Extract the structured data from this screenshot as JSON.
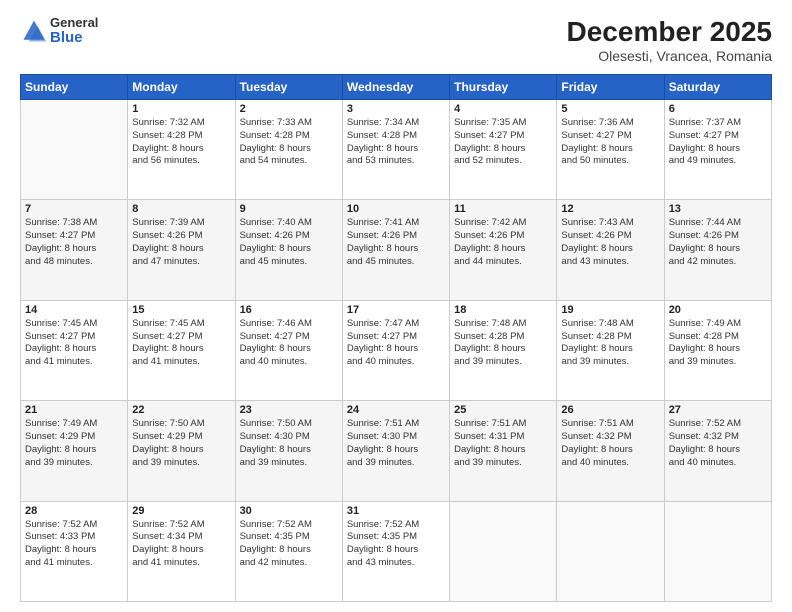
{
  "header": {
    "logo_general": "General",
    "logo_blue": "Blue",
    "title": "December 2025",
    "location": "Olesesti, Vrancea, Romania"
  },
  "days_of_week": [
    "Sunday",
    "Monday",
    "Tuesday",
    "Wednesday",
    "Thursday",
    "Friday",
    "Saturday"
  ],
  "weeks": [
    [
      {
        "day": "",
        "info": ""
      },
      {
        "day": "1",
        "info": "Sunrise: 7:32 AM\nSunset: 4:28 PM\nDaylight: 8 hours\nand 56 minutes."
      },
      {
        "day": "2",
        "info": "Sunrise: 7:33 AM\nSunset: 4:28 PM\nDaylight: 8 hours\nand 54 minutes."
      },
      {
        "day": "3",
        "info": "Sunrise: 7:34 AM\nSunset: 4:28 PM\nDaylight: 8 hours\nand 53 minutes."
      },
      {
        "day": "4",
        "info": "Sunrise: 7:35 AM\nSunset: 4:27 PM\nDaylight: 8 hours\nand 52 minutes."
      },
      {
        "day": "5",
        "info": "Sunrise: 7:36 AM\nSunset: 4:27 PM\nDaylight: 8 hours\nand 50 minutes."
      },
      {
        "day": "6",
        "info": "Sunrise: 7:37 AM\nSunset: 4:27 PM\nDaylight: 8 hours\nand 49 minutes."
      }
    ],
    [
      {
        "day": "7",
        "info": "Sunrise: 7:38 AM\nSunset: 4:27 PM\nDaylight: 8 hours\nand 48 minutes."
      },
      {
        "day": "8",
        "info": "Sunrise: 7:39 AM\nSunset: 4:26 PM\nDaylight: 8 hours\nand 47 minutes."
      },
      {
        "day": "9",
        "info": "Sunrise: 7:40 AM\nSunset: 4:26 PM\nDaylight: 8 hours\nand 45 minutes."
      },
      {
        "day": "10",
        "info": "Sunrise: 7:41 AM\nSunset: 4:26 PM\nDaylight: 8 hours\nand 45 minutes."
      },
      {
        "day": "11",
        "info": "Sunrise: 7:42 AM\nSunset: 4:26 PM\nDaylight: 8 hours\nand 44 minutes."
      },
      {
        "day": "12",
        "info": "Sunrise: 7:43 AM\nSunset: 4:26 PM\nDaylight: 8 hours\nand 43 minutes."
      },
      {
        "day": "13",
        "info": "Sunrise: 7:44 AM\nSunset: 4:26 PM\nDaylight: 8 hours\nand 42 minutes."
      }
    ],
    [
      {
        "day": "14",
        "info": "Sunrise: 7:45 AM\nSunset: 4:27 PM\nDaylight: 8 hours\nand 41 minutes."
      },
      {
        "day": "15",
        "info": "Sunrise: 7:45 AM\nSunset: 4:27 PM\nDaylight: 8 hours\nand 41 minutes."
      },
      {
        "day": "16",
        "info": "Sunrise: 7:46 AM\nSunset: 4:27 PM\nDaylight: 8 hours\nand 40 minutes."
      },
      {
        "day": "17",
        "info": "Sunrise: 7:47 AM\nSunset: 4:27 PM\nDaylight: 8 hours\nand 40 minutes."
      },
      {
        "day": "18",
        "info": "Sunrise: 7:48 AM\nSunset: 4:28 PM\nDaylight: 8 hours\nand 39 minutes."
      },
      {
        "day": "19",
        "info": "Sunrise: 7:48 AM\nSunset: 4:28 PM\nDaylight: 8 hours\nand 39 minutes."
      },
      {
        "day": "20",
        "info": "Sunrise: 7:49 AM\nSunset: 4:28 PM\nDaylight: 8 hours\nand 39 minutes."
      }
    ],
    [
      {
        "day": "21",
        "info": "Sunrise: 7:49 AM\nSunset: 4:29 PM\nDaylight: 8 hours\nand 39 minutes."
      },
      {
        "day": "22",
        "info": "Sunrise: 7:50 AM\nSunset: 4:29 PM\nDaylight: 8 hours\nand 39 minutes."
      },
      {
        "day": "23",
        "info": "Sunrise: 7:50 AM\nSunset: 4:30 PM\nDaylight: 8 hours\nand 39 minutes."
      },
      {
        "day": "24",
        "info": "Sunrise: 7:51 AM\nSunset: 4:30 PM\nDaylight: 8 hours\nand 39 minutes."
      },
      {
        "day": "25",
        "info": "Sunrise: 7:51 AM\nSunset: 4:31 PM\nDaylight: 8 hours\nand 39 minutes."
      },
      {
        "day": "26",
        "info": "Sunrise: 7:51 AM\nSunset: 4:32 PM\nDaylight: 8 hours\nand 40 minutes."
      },
      {
        "day": "27",
        "info": "Sunrise: 7:52 AM\nSunset: 4:32 PM\nDaylight: 8 hours\nand 40 minutes."
      }
    ],
    [
      {
        "day": "28",
        "info": "Sunrise: 7:52 AM\nSunset: 4:33 PM\nDaylight: 8 hours\nand 41 minutes."
      },
      {
        "day": "29",
        "info": "Sunrise: 7:52 AM\nSunset: 4:34 PM\nDaylight: 8 hours\nand 41 minutes."
      },
      {
        "day": "30",
        "info": "Sunrise: 7:52 AM\nSunset: 4:35 PM\nDaylight: 8 hours\nand 42 minutes."
      },
      {
        "day": "31",
        "info": "Sunrise: 7:52 AM\nSunset: 4:35 PM\nDaylight: 8 hours\nand 43 minutes."
      },
      {
        "day": "",
        "info": ""
      },
      {
        "day": "",
        "info": ""
      },
      {
        "day": "",
        "info": ""
      }
    ]
  ]
}
